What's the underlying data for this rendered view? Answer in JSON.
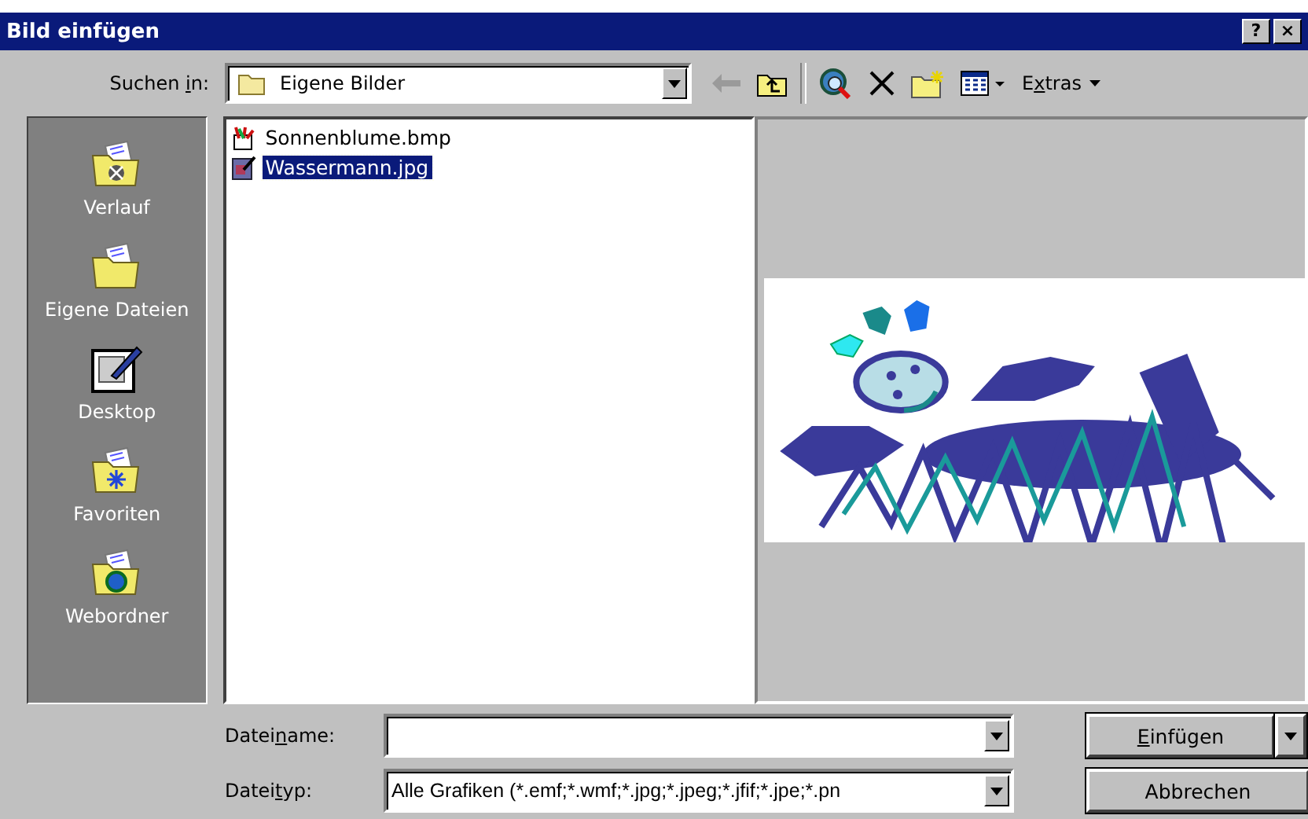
{
  "window": {
    "title": "Bild einfügen",
    "buttons": [
      "?",
      "×"
    ]
  },
  "look_in": {
    "label": [
      "Suchen ",
      "i",
      "n:"
    ],
    "value": "Eigene Bilder"
  },
  "toolbar": {
    "back_disabled": true,
    "extras": [
      "E",
      "x",
      "tras"
    ]
  },
  "places": [
    {
      "kind": "history",
      "label": "Verlauf"
    },
    {
      "kind": "documents",
      "label": "Eigene Dateien"
    },
    {
      "kind": "desktop",
      "label": "Desktop"
    },
    {
      "kind": "favorites",
      "label": "Favoriten"
    },
    {
      "kind": "web",
      "label": "Webordner"
    }
  ],
  "files": [
    {
      "kind": "bmp",
      "name": "Sonnenblume.bmp",
      "selected": false
    },
    {
      "kind": "jpg",
      "name": "Wassermann.jpg",
      "selected": true
    }
  ],
  "filename": {
    "label": [
      "Datei",
      "n",
      "ame:"
    ]
  },
  "filetype": {
    "label": [
      "Datei",
      "t",
      "yp:"
    ],
    "value": "Alle Grafiken (*.emf;*.wmf;*.jpg;*.jpeg;*.jfif;*.jpe;*.pn"
  },
  "buttons": {
    "insert": [
      "E",
      "infügen"
    ],
    "cancel": "Abbrechen"
  }
}
